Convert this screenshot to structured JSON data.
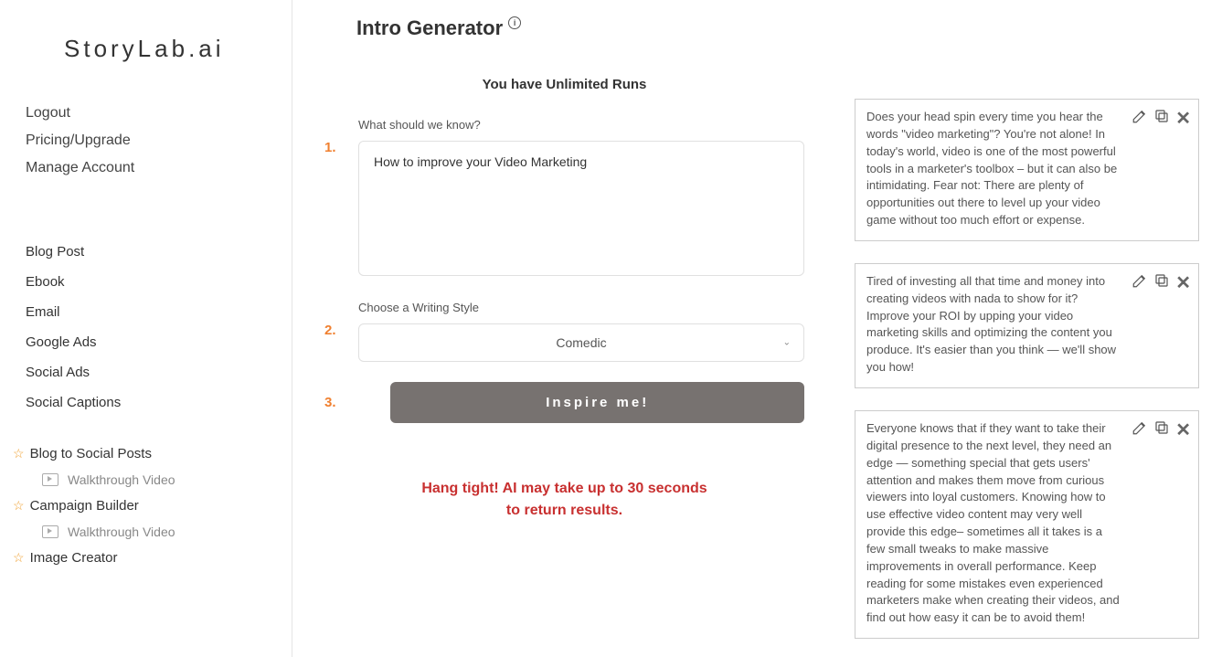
{
  "brand": "StoryLab.ai",
  "account_links": {
    "logout": "Logout",
    "pricing": "Pricing/Upgrade",
    "manage": "Manage Account"
  },
  "tools": {
    "blog_post": "Blog Post",
    "ebook": "Ebook",
    "email": "Email",
    "google_ads": "Google Ads",
    "social_ads": "Social Ads",
    "social_captions": "Social Captions"
  },
  "starred": {
    "blog_to_social": "Blog to Social Posts",
    "campaign_builder": "Campaign Builder",
    "image_creator": "Image Creator"
  },
  "sub": {
    "walkthrough": "Walkthrough Video"
  },
  "page": {
    "title": "Intro Generator",
    "runs_text": "You have Unlimited Runs",
    "wait_msg_line1": "Hang tight! AI may take up to 30 seconds",
    "wait_msg_line2": "to return results."
  },
  "form": {
    "num1": "1.",
    "num2": "2.",
    "num3": "3.",
    "label_know": "What should we know?",
    "input_value": "How to improve your Video Marketing",
    "label_style": "Choose a Writing Style",
    "style_selected": "Comedic",
    "inspire_btn": "Inspire me!"
  },
  "results": [
    {
      "text": "Does your head spin every time you hear the words \"video marketing\"? You're not alone! In today's world, video is one of the most powerful tools in a marketer's toolbox – but it can also be intimidating. Fear not: There are plenty of opportunities out there to level up your video game without too much effort or expense."
    },
    {
      "text": "Tired of investing all that time and money into creating videos with nada to show for it? Improve your ROI by upping your video marketing skills and optimizing the content you produce. It's easier than you think — we'll show you how!"
    },
    {
      "text": "Everyone knows that if they want to take their digital presence to the next level, they need an edge — something special that gets users' attention and makes them move from curious viewers into loyal customers. Knowing how to use effective video content may very well provide this edge– sometimes all it takes is a few small tweaks to make massive improvements in overall performance. Keep reading for some mistakes even experienced marketers make when creating their videos, and find out how easy it can be to avoid them!"
    }
  ]
}
